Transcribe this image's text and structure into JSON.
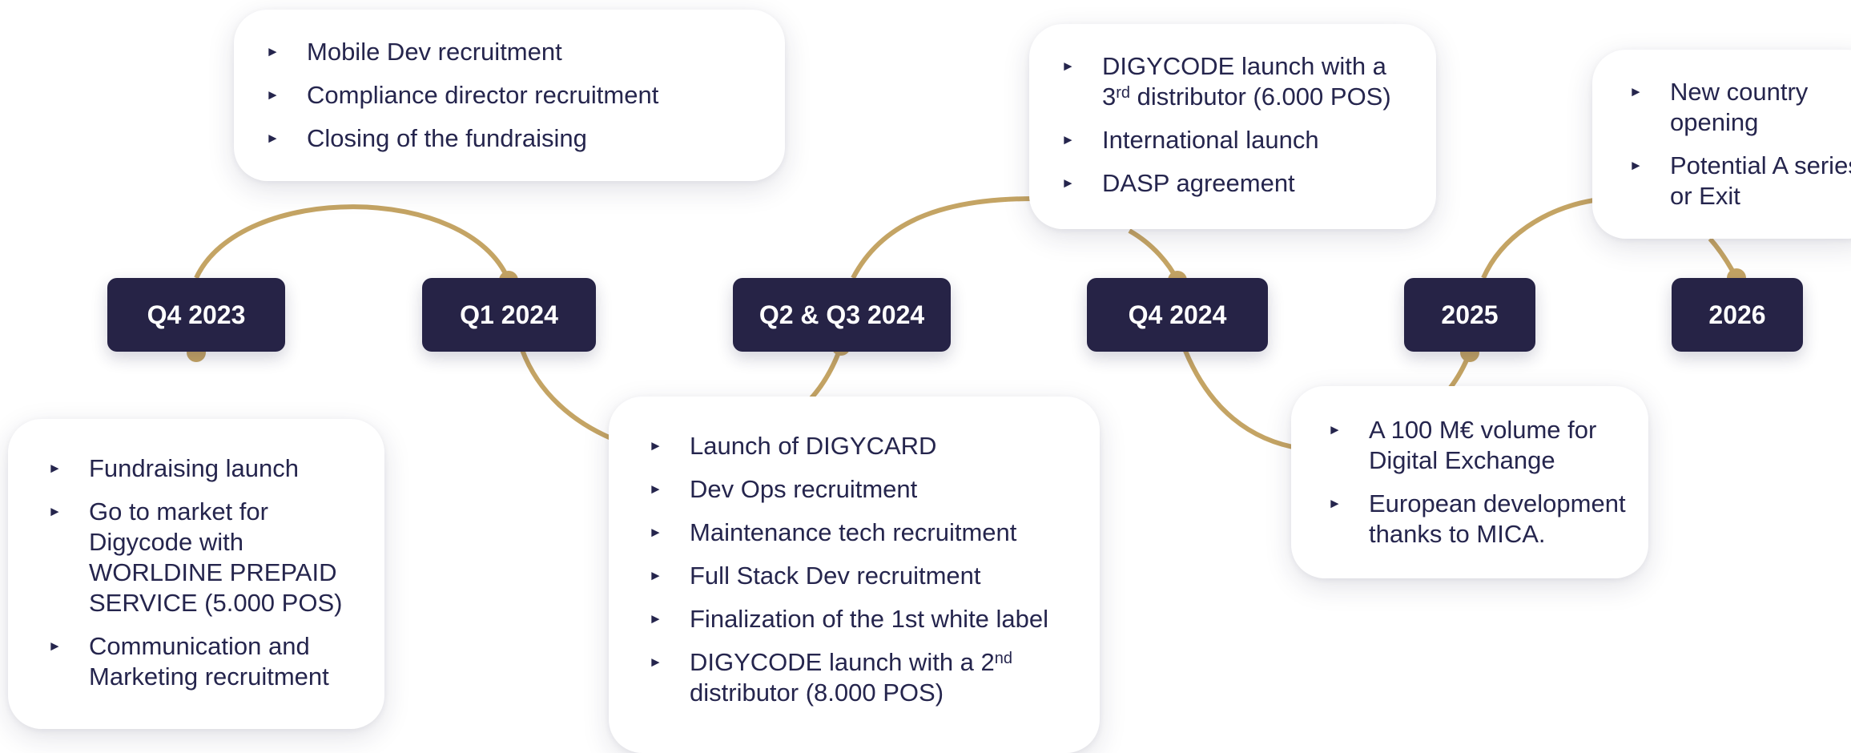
{
  "colors": {
    "pill_bg": "#262346",
    "pill_text": "#ffffff",
    "curve": "#c4a464",
    "body_text": "#25254d",
    "card_bg": "#ffffff"
  },
  "bullet_glyph": "►",
  "milestones": [
    {
      "id": "q4-2023",
      "label": "Q4 2023"
    },
    {
      "id": "q1-2024",
      "label": "Q1 2024"
    },
    {
      "id": "q2-q3-2024",
      "label": "Q2 & Q3 2024"
    },
    {
      "id": "q4-2024",
      "label": "Q4 2024"
    },
    {
      "id": "2025",
      "label": "2025"
    },
    {
      "id": "2026",
      "label": "2026"
    }
  ],
  "cards": {
    "q4_2023": [
      {
        "text": "Fundraising launch"
      },
      {
        "text": "Go to market for Digycode with WORLDINE PREPAID SERVICE (5.000 POS)"
      },
      {
        "text": "Communication and Marketing recruitment"
      }
    ],
    "q1_2024": [
      {
        "text": "Mobile Dev recruitment"
      },
      {
        "text": "Compliance director recruitment"
      },
      {
        "text": "Closing of the fundraising"
      }
    ],
    "q2_q3_2024": [
      {
        "text": "Launch of DIGYCARD"
      },
      {
        "text": "Dev Ops recruitment"
      },
      {
        "text": "Maintenance tech recruitment"
      },
      {
        "text": "Full Stack Dev recruitment"
      },
      {
        "text": "Finalization of the 1st white label"
      },
      {
        "text_before": "DIGYCODE launch with a 2",
        "sup": "nd",
        "text_after": " distributor (8.000 POS)"
      }
    ],
    "q4_2024": [
      {
        "text_before": "DIGYCODE launch with a 3",
        "sup": "rd",
        "text_after": " distributor (6.000 POS)"
      },
      {
        "text": "International launch"
      },
      {
        "text": "DASP agreement"
      }
    ],
    "y2025": [
      {
        "text": "A 100 M€ volume for Digital Exchange"
      },
      {
        "text": "European development thanks to MICA."
      }
    ],
    "y2026": [
      {
        "text": "New country opening"
      },
      {
        "text": "Potential A series or Exit"
      }
    ]
  }
}
